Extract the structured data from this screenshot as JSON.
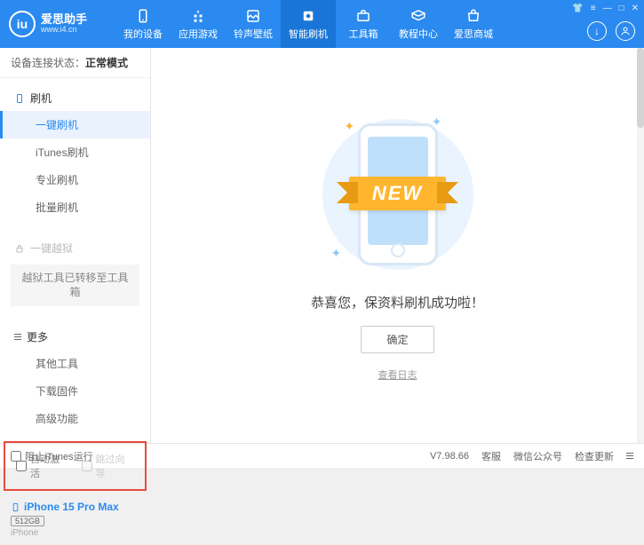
{
  "app": {
    "title": "爱思助手",
    "url": "www.i4.cn"
  },
  "nav": [
    {
      "label": "我的设备"
    },
    {
      "label": "应用游戏"
    },
    {
      "label": "铃声壁纸"
    },
    {
      "label": "智能刷机",
      "active": true
    },
    {
      "label": "工具箱"
    },
    {
      "label": "教程中心"
    },
    {
      "label": "爱思商城"
    }
  ],
  "status": {
    "label": "设备连接状态：",
    "value": "正常模式"
  },
  "sidebar": {
    "flash": {
      "head": "刷机",
      "items": [
        "一键刷机",
        "iTunes刷机",
        "专业刷机",
        "批量刷机"
      ]
    },
    "jailbreak": {
      "head": "一键越狱",
      "note": "越狱工具已转移至工具箱"
    },
    "more": {
      "head": "更多",
      "items": [
        "其他工具",
        "下载固件",
        "高级功能"
      ]
    },
    "checkboxes": {
      "auto_activate": "自动激活",
      "skip_guide": "跳过向导"
    },
    "device": {
      "name": "iPhone 15 Pro Max",
      "storage": "512GB",
      "type": "iPhone"
    }
  },
  "main": {
    "ribbon": "NEW",
    "message": "恭喜您，保资料刷机成功啦！",
    "ok": "确定",
    "log_link": "查看日志"
  },
  "footer": {
    "block_itunes": "阻止iTunes运行",
    "version": "V7.98.66",
    "links": [
      "客服",
      "微信公众号",
      "检查更新"
    ]
  }
}
